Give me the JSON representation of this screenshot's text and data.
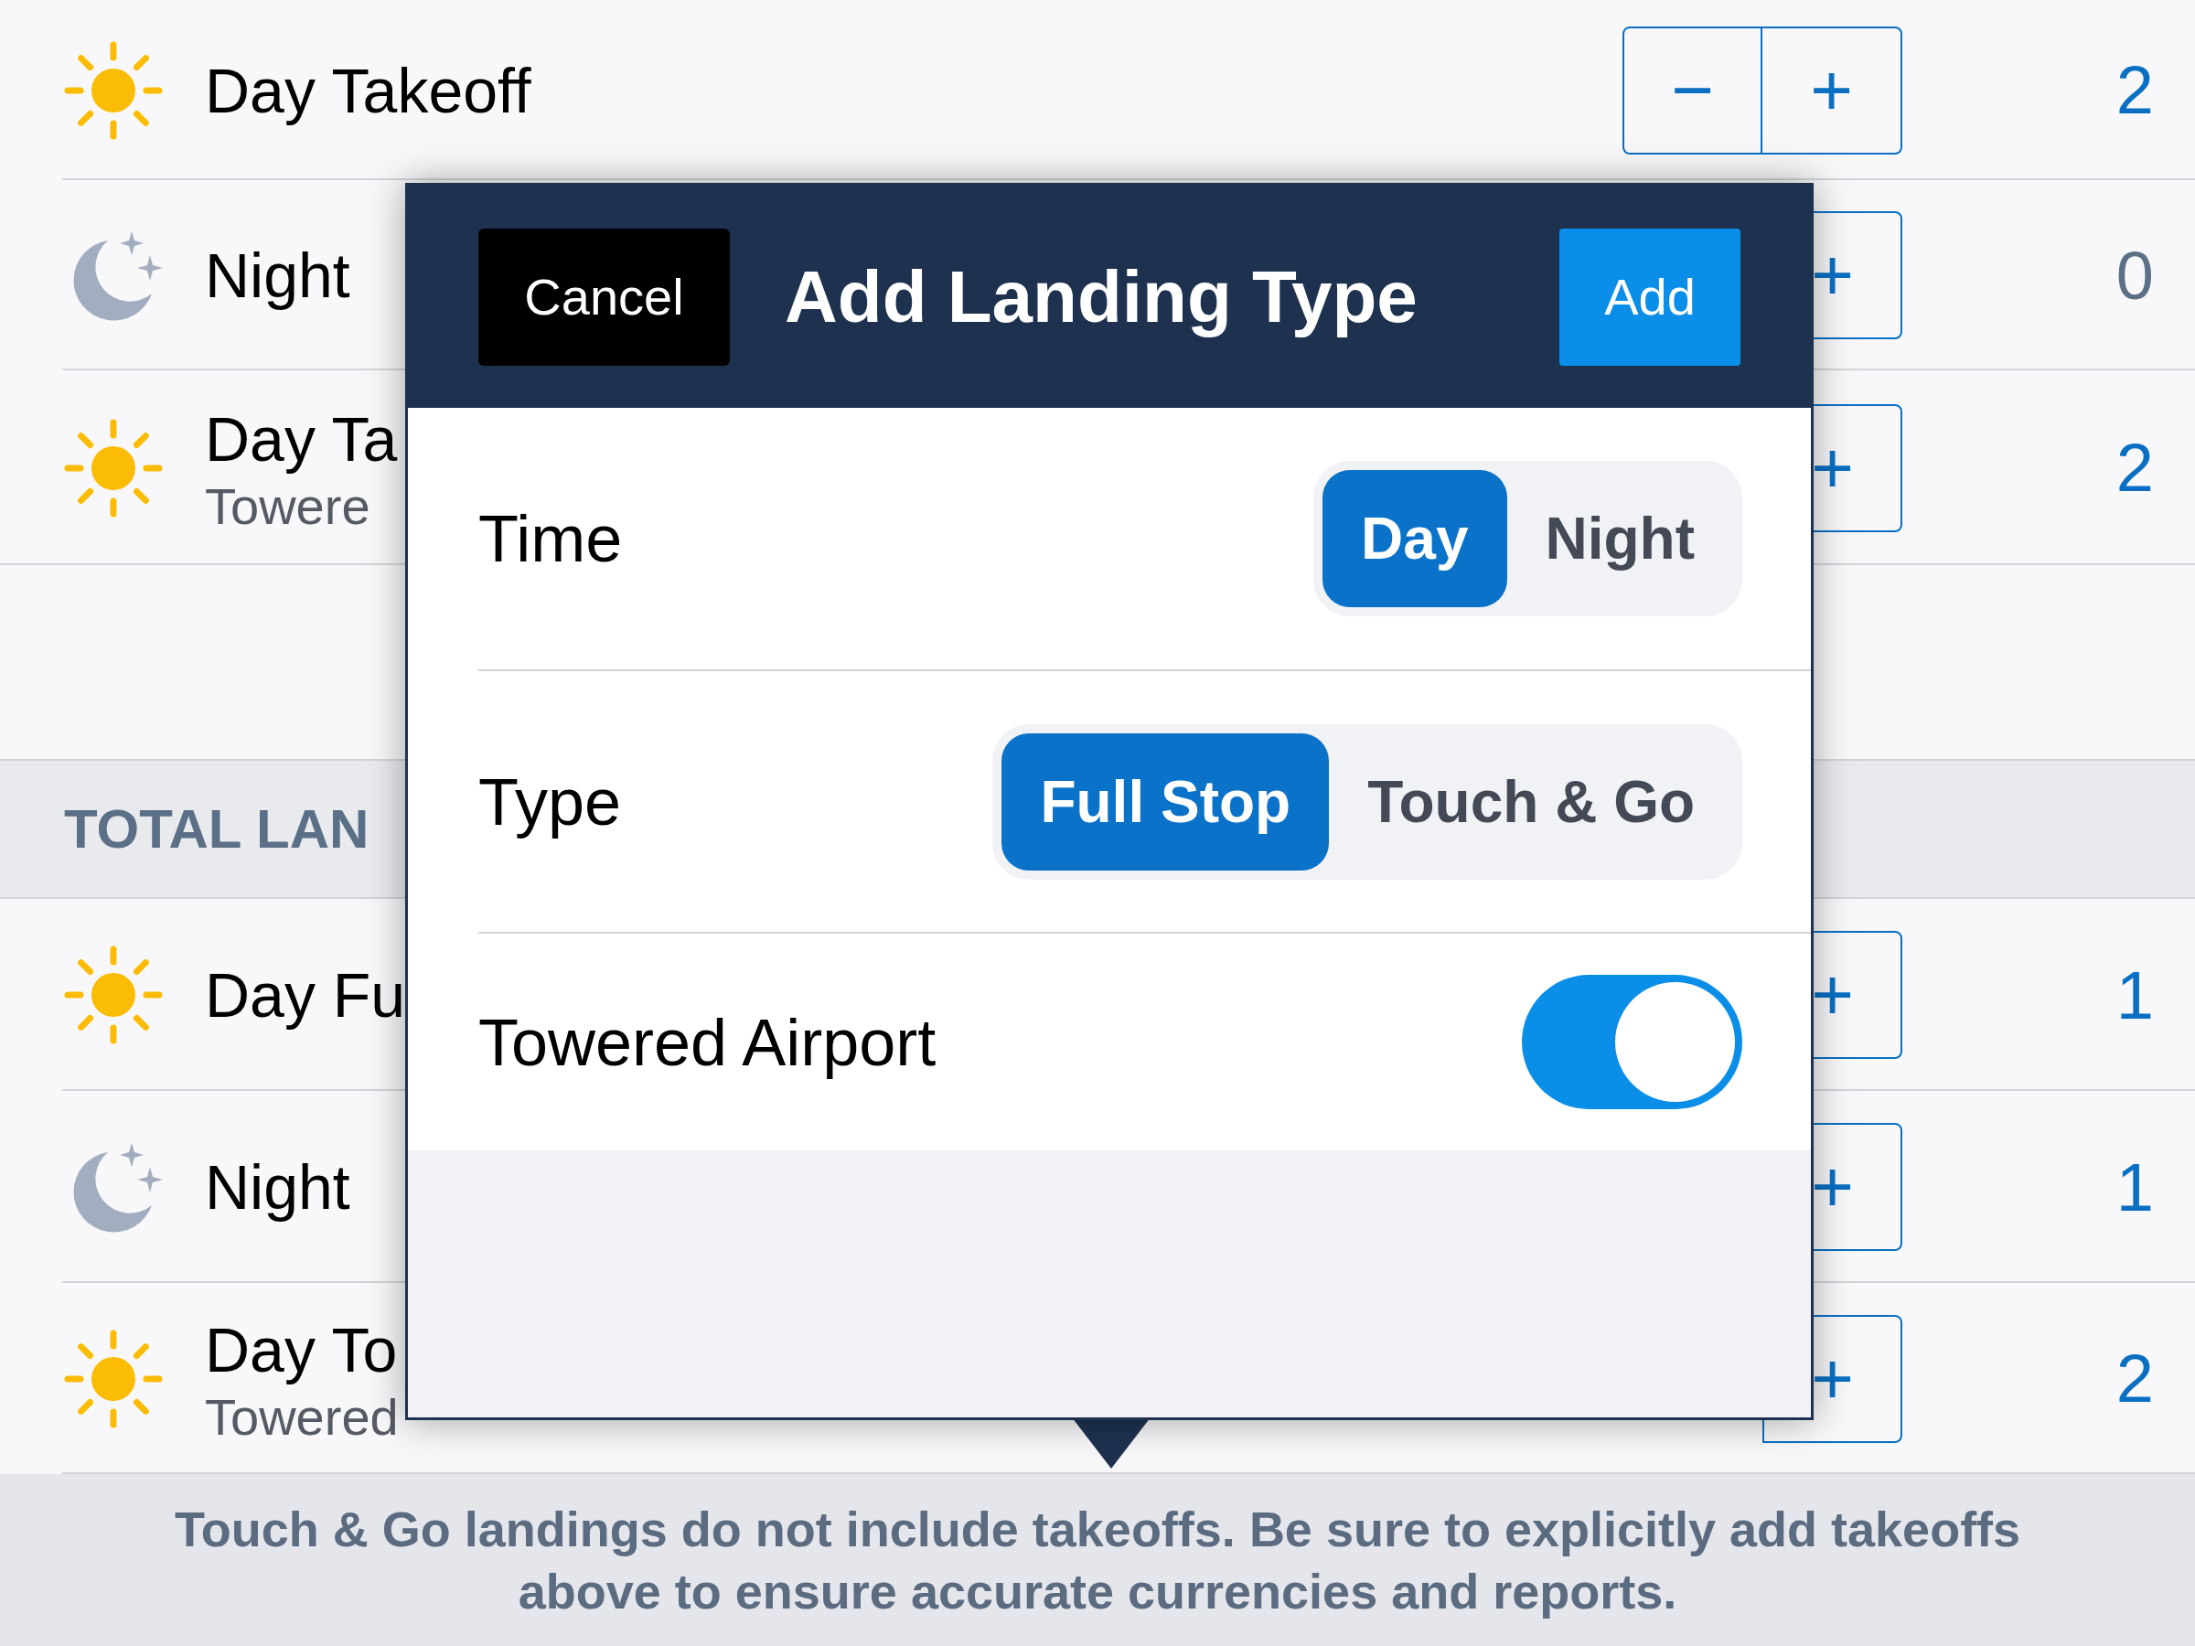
{
  "sections": [
    {
      "rows": [
        {
          "kind": "day",
          "title": "Day Takeoff",
          "buttons": [
            "−",
            "+"
          ],
          "count": "2",
          "color": "#0a6fc2"
        },
        {
          "kind": "night",
          "title": "Night",
          "buttons": [
            "+"
          ],
          "count": "0",
          "color": "#5b6f86"
        },
        {
          "kind": "day",
          "title": "Day Ta",
          "subtitle": "Towere",
          "buttons": [
            "+"
          ],
          "count": "2",
          "color": "#0a6fc2"
        }
      ]
    },
    {
      "header": "TOTAL LAN",
      "rows": [
        {
          "kind": "day",
          "title": "Day Fu",
          "buttons": [
            "+"
          ],
          "count": "1",
          "color": "#0a6fc2"
        },
        {
          "kind": "night",
          "title": "Night",
          "buttons": [
            "+"
          ],
          "count": "1",
          "color": "#0a6fc2"
        },
        {
          "kind": "day",
          "title": "Day To",
          "subtitle": "Towered",
          "buttons": [
            "+"
          ],
          "count": "2",
          "color": "#0a6fc2"
        }
      ]
    }
  ],
  "popover": {
    "cancel": "Cancel",
    "title": "Add Landing Type",
    "add": "Add",
    "fields": [
      {
        "kind": "segmented",
        "label": "Time",
        "options": [
          {
            "label": "Day",
            "selected": true
          },
          {
            "label": "Night",
            "selected": false
          }
        ]
      },
      {
        "kind": "segmented",
        "label": "Type",
        "options": [
          {
            "label": "Full Stop",
            "selected": true
          },
          {
            "label": "Touch & Go",
            "selected": false
          }
        ]
      },
      {
        "kind": "toggle",
        "label": "Towered Airport",
        "on": true
      }
    ]
  },
  "footer": "Touch & Go landings do not include takeoffs. Be sure to explicitly add takeoffs above to ensure accurate currencies and reports."
}
